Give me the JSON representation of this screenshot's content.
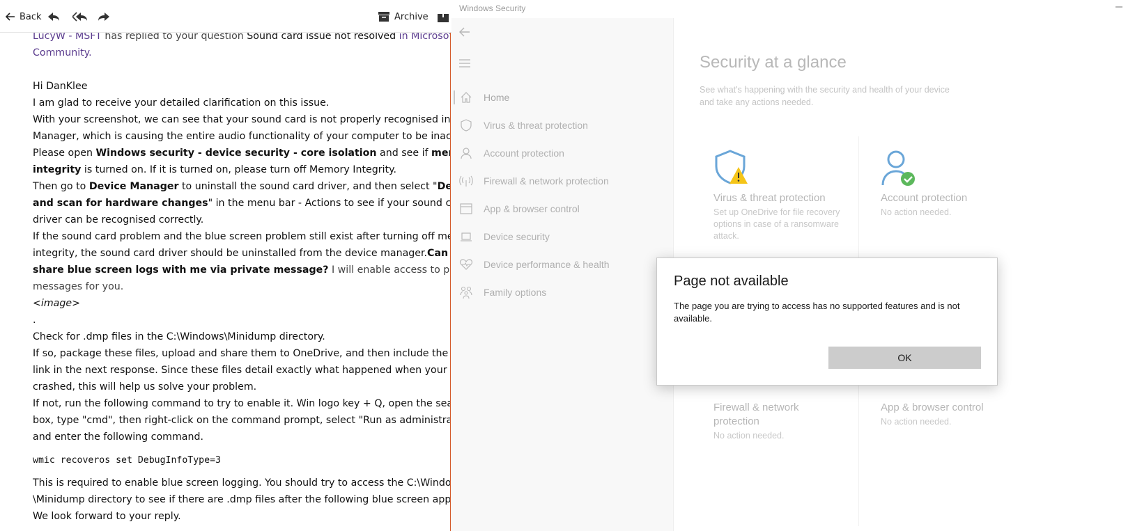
{
  "mail": {
    "toolbar": {
      "back_label": "Back",
      "archive_label": "Archive"
    },
    "body": {
      "intro": {
        "author": "LucyW - MSFT",
        "replied_text": " has replied to your question ",
        "question": "Sound card issue not resolved",
        "in_text": " in Microsoft",
        "community": "Community."
      },
      "greeting": "Hi DanKlee",
      "line1": "I am glad to receive your detailed clarification on this issue.",
      "line2": "With your screenshot, we can see that your sound card is not properly recognised in Device",
      "line3": "Manager, which is causing the entire audio functionality of your computer to be inactive.",
      "line4_a": "Please open ",
      "line4_b": "Windows security - device security - core isolation",
      "line4_c": " and see if ",
      "line4_d": "memory",
      "line5_a": "integrity",
      "line5_b": " is turned on. If it is turned on, please turn off Memory Integrity.",
      "line6_a": "Then go to ",
      "line6_b": "Device Manager",
      "line6_c": " to uninstall the sound card driver, and then select \"",
      "line6_d": "Detect",
      "line7_a": "and scan for hardware changes",
      "line7_b": "\" in the menu bar - Actions to see if your sound card",
      "line8": "driver can be recognised correctly.",
      "line9": "If the sound card problem and the blue screen problem still exist after turning off memory",
      "line10_a": "integrity, the sound card driver should be uninstalled from the device manager.",
      "line10_b": "Can you",
      "line11_a": "share blue screen logs with me via private message?",
      "line11_b": " I will enable access to private",
      "line12": "messages for you.",
      "image_placeholder": "<image>",
      "dot": ".",
      "line13": "Check for .dmp files in the C:\\Windows\\Minidump directory.",
      "line14": "If so, package these files, upload and share them to OneDrive, and then include the sharing",
      "line15": "link in the next response. Since these files detail exactly what happened when your system",
      "line16": "crashed, this will help us solve your problem.",
      "line17": "If not, run the following command to try to enable it. Win logo key + Q, open the search",
      "line18": "box, type \"cmd\", then right-click on the command prompt, select \"Run as administrator\")",
      "line19": "and enter the following command.",
      "code": "wmic recoveros set DebugInfoType=3",
      "line20": "This is required to enable blue screen logging. You should try to access the C:\\Windows",
      "line21": "\\Minidump directory to see if there are .dmp files after the following blue screen appears.",
      "line22": "We look forward to your reply."
    }
  },
  "security": {
    "window_title": "Windows Security",
    "nav": [
      {
        "label": "Home",
        "icon": "home-icon"
      },
      {
        "label": "Virus & threat protection",
        "icon": "shield-icon"
      },
      {
        "label": "Account protection",
        "icon": "person-icon"
      },
      {
        "label": "Firewall & network protection",
        "icon": "antenna-icon"
      },
      {
        "label": "App & browser control",
        "icon": "browser-window-icon"
      },
      {
        "label": "Device security",
        "icon": "laptop-icon"
      },
      {
        "label": "Device performance & health",
        "icon": "heart-icon"
      },
      {
        "label": "Family options",
        "icon": "family-icon"
      }
    ],
    "main": {
      "title": "Security at a glance",
      "subtitle": "See what's happening with the security and health of your device and take any actions needed.",
      "tiles": [
        {
          "title": "Virus & threat protection",
          "desc": "Set up OneDrive for file recovery options in case of a ransomware attack."
        },
        {
          "title": "Account protection",
          "desc": "No action needed."
        },
        {
          "title": "Firewall & network protection",
          "desc": "No action needed."
        },
        {
          "title": "App & browser control",
          "desc": "No action needed."
        }
      ]
    },
    "dialog": {
      "title": "Page not available",
      "message": "The page you are trying to access has no supported features and is not available.",
      "ok_label": "OK"
    },
    "colors": {
      "accent_blue": "#6aa6d8",
      "warning_yellow": "#f5c518",
      "ok_green": "#5cb85c",
      "window_border": "#d45a2a"
    }
  }
}
